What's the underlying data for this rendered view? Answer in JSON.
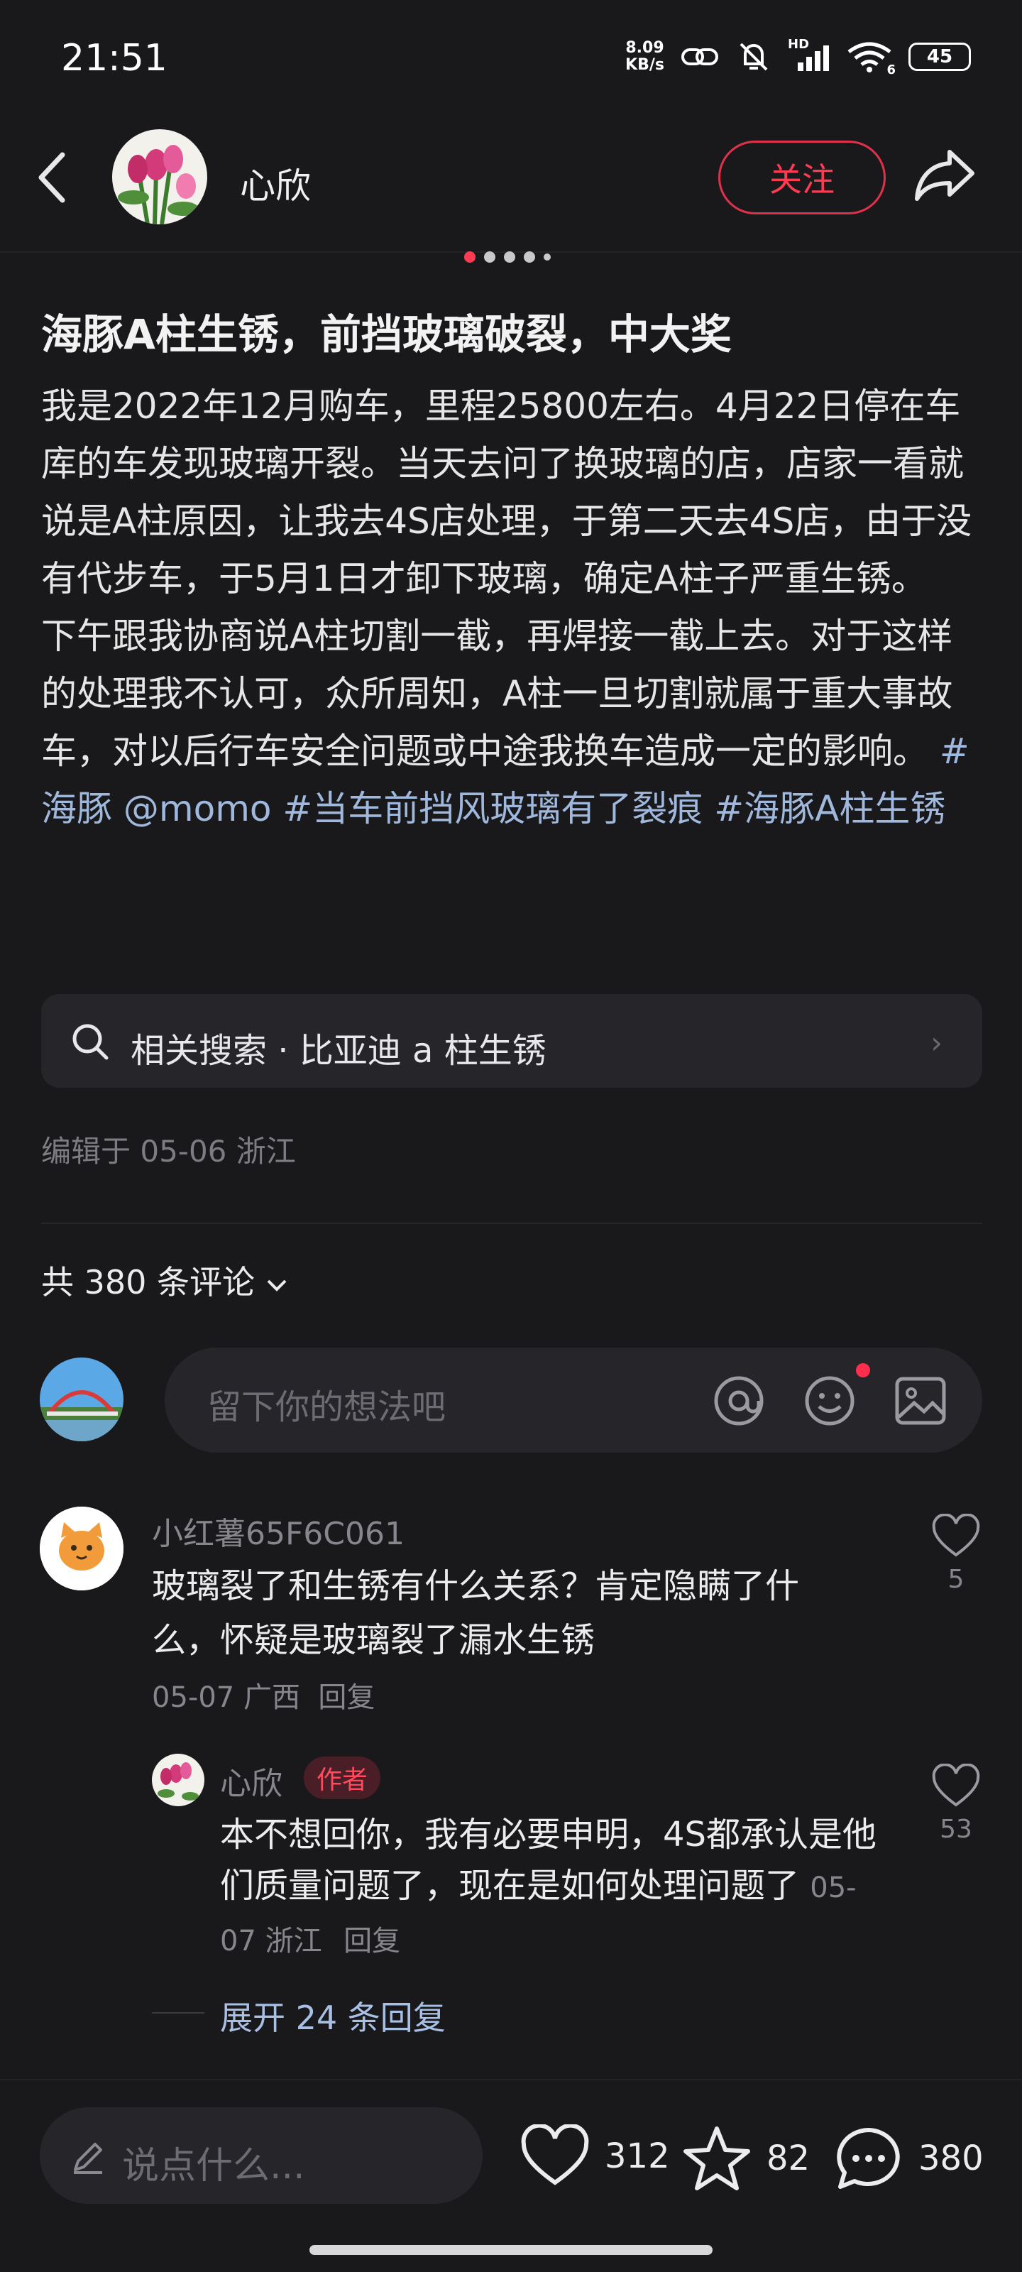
{
  "status_bar": {
    "time": "21:51",
    "net_speed_value": "8.09",
    "net_speed_unit": "KB/s",
    "battery": "45",
    "wifi_label": "6",
    "hd_label": "HD"
  },
  "header": {
    "author_name": "心欣",
    "follow_label": "关注",
    "icons": [
      "back-arrow-icon",
      "share-icon"
    ]
  },
  "post": {
    "title": "海豚A柱生锈，前挡玻璃破裂，中大奖",
    "body": "我是2022年12月购车，里程25800左右。4月22日停在车库的车发现玻璃开裂。当天去问了换玻璃的店，店家一看就说是A柱原因，让我去4S店处理，于第二天去4S店，由于没有代步车，于5月1日才卸下玻璃，确定A柱子严重生锈。\n下午跟我协商说A柱切割一截，再焊接一截上去。对于这样的处理我不认可，众所周知，A柱一旦切割就属于重大事故车，对以后行车安全问题或中途我换车造成一定的影响。",
    "tags": [
      "#海豚",
      "@momo",
      "#当车前挡风玻璃有了裂痕",
      "#海豚A柱生锈"
    ],
    "related_search": "相关搜索 · 比亚迪 a 柱生锈",
    "edited": "编辑于 05-06 浙江"
  },
  "comments_section": {
    "count_label": "共 380 条评论",
    "input_placeholder": "留下你的想法吧",
    "comments": [
      {
        "user": "小红薯65F6C061",
        "text": "玻璃裂了和生锈有什么关系？肯定隐瞒了什么，怀疑是玻璃裂了漏水生锈",
        "meta": "05-07 广西",
        "reply_label": "回复",
        "likes": "5"
      }
    ],
    "reply": {
      "user": "心欣",
      "badge": "作者",
      "text": "本不想回你，我有必要申明，4S都承认是他们质量问题了，现在是如何处理问题了",
      "meta": "05-07 浙江",
      "reply_label": "回复",
      "likes": "53"
    },
    "expand_label": "展开 24 条回复"
  },
  "bottom_bar": {
    "say_placeholder": "说点什么...",
    "likes": "312",
    "stars": "82",
    "comments": "380"
  },
  "colors": {
    "accent_red": "#ff3b54",
    "tag_blue": "#9fb8dc",
    "background": "#19191c"
  }
}
